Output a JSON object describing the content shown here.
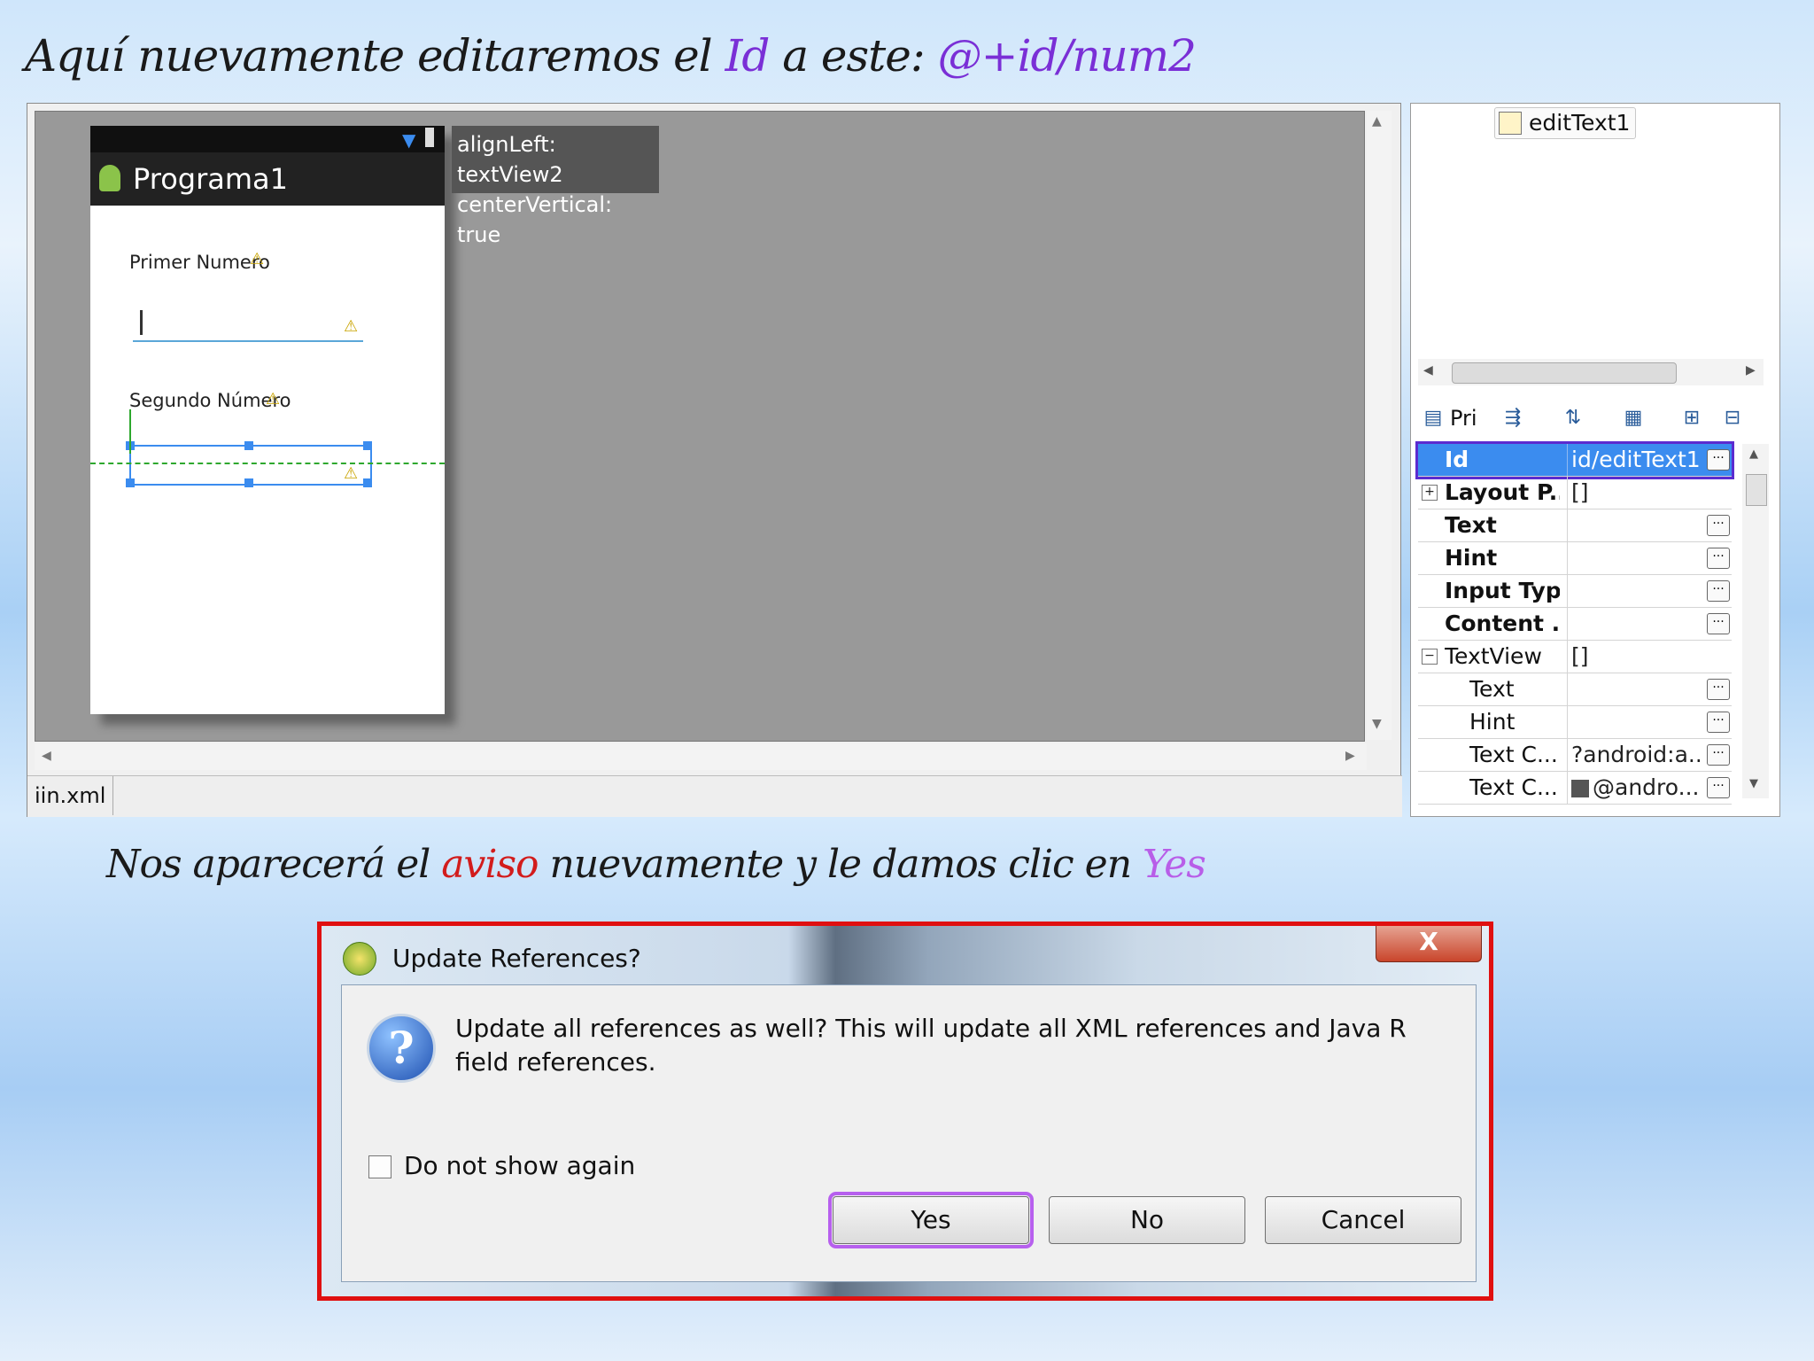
{
  "heading": {
    "pre": "Aquí nuevamente editaremos el ",
    "id_word": "Id",
    "mid": " a este: ",
    "new_id": "@+id/num2"
  },
  "subheading": {
    "pre": "Nos aparecerá el ",
    "aviso": "aviso",
    "mid": " nuevamente y le damos clic en ",
    "yes": "Yes"
  },
  "editor": {
    "app_title": "Programa1",
    "tooltip_line1": "alignLeft: textView2",
    "tooltip_line2": "centerVertical: true",
    "label1": "Primer Numero",
    "label2": "Segundo Número",
    "file_tab": "iin.xml"
  },
  "outline": {
    "node": "editText1"
  },
  "properties": {
    "toolbar_label": "Pri",
    "rows": [
      {
        "key": "Id",
        "value": "id/editText1",
        "bold": true,
        "selected": true
      },
      {
        "key": "Layout P...",
        "value": "[]",
        "bold": true,
        "expander": "+"
      },
      {
        "key": "Text",
        "value": "",
        "bold": true
      },
      {
        "key": "Hint",
        "value": "",
        "bold": true
      },
      {
        "key": "Input Type",
        "value": "",
        "bold": true
      },
      {
        "key": "Content ...",
        "value": "",
        "bold": true
      },
      {
        "key": "TextView",
        "value": "[]",
        "bold": false,
        "expander": "−"
      },
      {
        "key": "Text",
        "value": "",
        "bold": false,
        "indent": true
      },
      {
        "key": "Hint",
        "value": "",
        "bold": false,
        "indent": true
      },
      {
        "key": "Text C...",
        "value": "?android:a...",
        "bold": false,
        "indent": true
      },
      {
        "key": "Text C...",
        "value": "@andro...",
        "bold": false,
        "indent": true,
        "swatch": "#555555"
      }
    ]
  },
  "dialog": {
    "title": "Update References?",
    "message": "Update all references as well? This will update all XML references and Java R field references.",
    "checkbox_label": "Do not show again",
    "checkbox_checked": false,
    "yes": "Yes",
    "no": "No",
    "cancel": "Cancel",
    "close_glyph": "X"
  },
  "colors": {
    "highlight_purple": "#7a2fd6",
    "warning_red": "#d21c1c",
    "frame_red": "#e01010",
    "selection_blue": "#3b8cef"
  }
}
